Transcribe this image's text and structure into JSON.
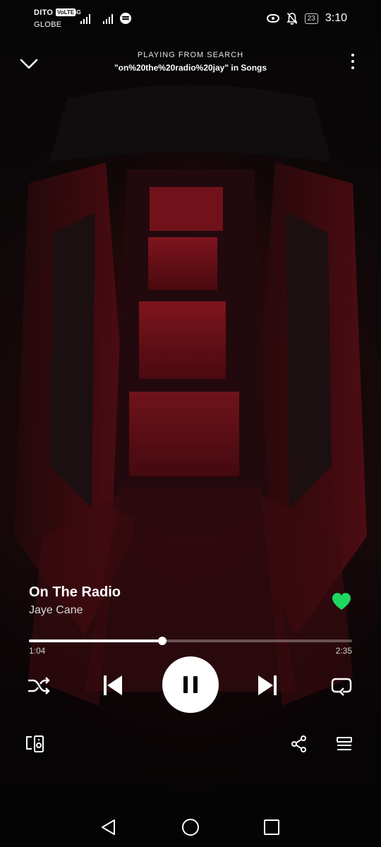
{
  "status_bar": {
    "carrier_1": "DITO",
    "volte_badge": "VoLTE",
    "network_type": "4G",
    "carrier_2": "GLOBE",
    "battery": "23",
    "time": "3:10"
  },
  "header": {
    "context_label": "PLAYING FROM SEARCH",
    "context_title": "\"on%20the%20radio%20jay\" in Songs"
  },
  "track": {
    "title": "On The Radio",
    "artist": "Jaye Cane",
    "liked": true
  },
  "playback": {
    "elapsed": "1:04",
    "duration": "2:35",
    "progress_fraction": 0.413,
    "state": "playing"
  },
  "icons": {
    "collapse": "chevron-down-icon",
    "more": "more-vertical-icon",
    "heart": "heart-filled-icon",
    "shuffle": "shuffle-icon",
    "previous": "skip-previous-icon",
    "pause": "pause-icon",
    "next": "skip-next-icon",
    "repeat": "repeat-icon",
    "devices": "connect-device-icon",
    "share": "share-icon",
    "queue": "queue-icon",
    "nav_back": "nav-back-icon",
    "nav_home": "nav-home-icon",
    "nav_recents": "nav-recents-icon"
  },
  "colors": {
    "accent_green": "#1ED760",
    "background": "#0b0708",
    "album_red": "#8a1420"
  }
}
